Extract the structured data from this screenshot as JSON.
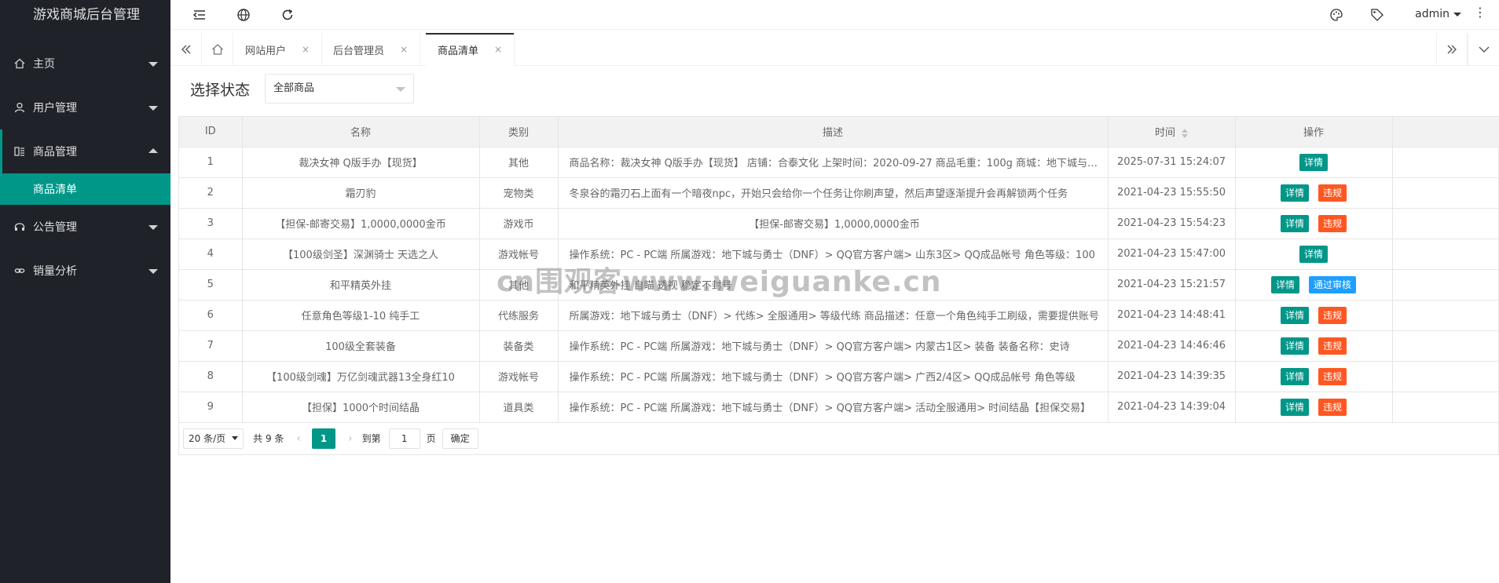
{
  "app": {
    "title": "游戏商城后台管理"
  },
  "sidebar": {
    "items": [
      {
        "label": "主页",
        "icon": "home-icon",
        "open": false
      },
      {
        "label": "用户管理",
        "icon": "user-icon",
        "open": false
      },
      {
        "label": "商品管理",
        "icon": "goods-icon",
        "open": true,
        "children": [
          "商品清单"
        ]
      },
      {
        "label": "公告管理",
        "icon": "headset-icon",
        "open": false
      },
      {
        "label": "销量分析",
        "icon": "link-icon",
        "open": false
      }
    ]
  },
  "header": {
    "user": "admin",
    "more": "⋮"
  },
  "tabs": [
    {
      "label": "网站用户",
      "close": "×"
    },
    {
      "label": "后台管理员",
      "close": "×"
    },
    {
      "label": "商品清单",
      "close": "×",
      "active": true
    }
  ],
  "filter": {
    "label": "选择状态",
    "selected": "全部商品"
  },
  "table": {
    "headers": [
      "ID",
      "名称",
      "类别",
      "描述",
      "时间",
      "操作"
    ],
    "rows": [
      {
        "id": "1",
        "name": "裁决女神 Q版手办【现货】",
        "category": "其他",
        "desc": "商品名称：裁决女神 Q版手办【现货】 店铺：合泰文化 上架时间：2020-09-27 商品毛重：100g 商城：地下城与勇士",
        "time": "2025-07-31 15:24:07",
        "actions": [
          "详情"
        ]
      },
      {
        "id": "2",
        "name": "霜刃豹",
        "category": "宠物类",
        "desc": "冬泉谷的霜刃石上面有一个暗夜npc，开始只会给你一个任务让你刷声望，然后声望逐渐提升会再解锁两个任务",
        "time": "2021-04-23 15:55:50",
        "actions": [
          "详情",
          "违规"
        ]
      },
      {
        "id": "3",
        "name": "【担保-邮寄交易】1,0000,0000金币",
        "category": "游戏币",
        "desc": "【担保-邮寄交易】1,0000,0000金币",
        "time": "2021-04-23 15:54:23",
        "actions": [
          "详情",
          "违规"
        ],
        "center": true
      },
      {
        "id": "4",
        "name": "【100级剑圣】深渊骑士 天选之人",
        "category": "游戏帐号",
        "desc": "操作系统：PC - PC端 所属游戏：地下城与勇士（DNF）> QQ官方客户端> 山东3区> QQ成品帐号 角色等级：100",
        "time": "2021-04-23 15:47:00",
        "actions": [
          "详情"
        ]
      },
      {
        "id": "5",
        "name": "和平精英外挂",
        "category": "其他",
        "desc": "和平精英外挂 自瞄 透视 稳定不封号",
        "time": "2021-04-23 15:21:57",
        "actions": [
          "详情",
          "通过审核"
        ]
      },
      {
        "id": "6",
        "name": "任意角色等级1-10 纯手工",
        "category": "代练服务",
        "desc": "所属游戏：地下城与勇士（DNF）> 代练> 全服通用> 等级代练 商品描述：任意一个角色纯手工刷级，需要提供账号",
        "time": "2021-04-23 14:48:41",
        "actions": [
          "详情",
          "违规"
        ]
      },
      {
        "id": "7",
        "name": "100级全套装备",
        "category": "装备类",
        "desc": "操作系统：PC - PC端 所属游戏：地下城与勇士（DNF）> QQ官方客户端> 内蒙古1区> 装备 装备名称：史诗",
        "time": "2021-04-23 14:46:46",
        "actions": [
          "详情",
          "违规"
        ]
      },
      {
        "id": "8",
        "name": "【100级剑魂】万亿剑魂武器13全身红10",
        "category": "游戏帐号",
        "desc": "操作系统：PC - PC端 所属游戏：地下城与勇士（DNF）> QQ官方客户端> 广西2/4区> QQ成品帐号 角色等级",
        "time": "2021-04-23 14:39:35",
        "actions": [
          "详情",
          "违规"
        ]
      },
      {
        "id": "9",
        "name": "【担保】1000个时间结晶",
        "category": "道具类",
        "desc": "操作系统：PC - PC端 所属游戏：地下城与勇士（DNF）> QQ官方客户端> 活动全服通用> 时间结晶【担保交易】",
        "time": "2021-04-23 14:39:04",
        "actions": [
          "详情",
          "违规"
        ]
      }
    ]
  },
  "pager": {
    "per_page": "20 条/页",
    "total": "共 9 条",
    "prev": "‹",
    "next": "›",
    "current": "1",
    "goto_label": "到第",
    "goto_value": "1",
    "page_unit": "页",
    "confirm": "确定"
  },
  "watermark": "cn围观客www.weiguanke.cn",
  "colors": {
    "sidebar_bg": "#20222a",
    "accent": "#009688",
    "danger": "#ff5722",
    "info": "#1e9fff"
  }
}
